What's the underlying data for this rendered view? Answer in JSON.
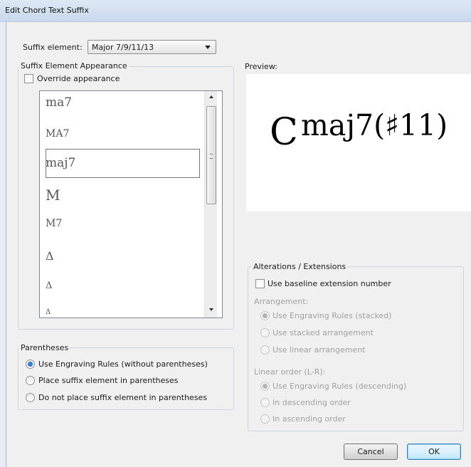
{
  "window": {
    "title": "Edit Chord Text Suffix"
  },
  "suffix_element": {
    "label": "Suffix element:",
    "value": "Major 7/9/11/13"
  },
  "appearance": {
    "group_title": "Suffix Element Appearance",
    "override_label": "Override appearance",
    "override_checked": false,
    "list_items": [
      "ma7",
      "MA7",
      "maj7",
      "M",
      "M7",
      "Δ",
      "Δ",
      "Δ"
    ],
    "selected_index": 2
  },
  "preview": {
    "label": "Preview:",
    "root": "C",
    "suffix": "maj7(♯11)"
  },
  "parentheses": {
    "group_title": "Parentheses",
    "options": [
      "Use Engraving Rules (without parentheses)",
      "Place suffix element in parentheses",
      "Do not place suffix element in parentheses"
    ],
    "selected_index": 0
  },
  "alterations": {
    "group_title": "Alterations / Extensions",
    "baseline_label": "Use baseline extension number",
    "baseline_checked": false,
    "arrangement_label": "Arrangement:",
    "arrangement_options": [
      "Use Engraving Rules (stacked)",
      "Use stacked arrangement",
      "Use linear arrangement"
    ],
    "arrangement_selected": 0,
    "order_label": "Linear order (L-R):",
    "order_options": [
      "Use Engraving Rules (descending)",
      "In descending order",
      "In ascending order"
    ],
    "order_selected": 0
  },
  "buttons": {
    "cancel": "Cancel",
    "ok": "OK"
  },
  "colors": {
    "accent": "#1a5fb4",
    "disabled_text": "#a0a0a0",
    "titlebar": "#c9d8ec"
  }
}
